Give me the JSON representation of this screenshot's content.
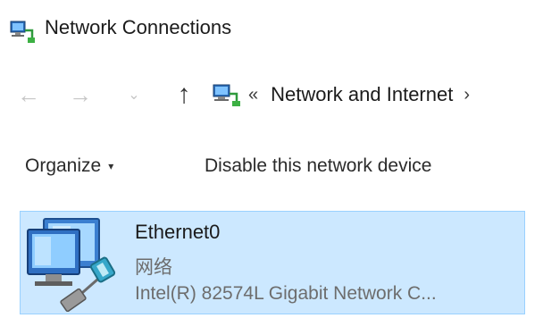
{
  "window": {
    "title": "Network Connections",
    "icon": "network-connections-icon"
  },
  "nav": {
    "back_glyph": "←",
    "forward_glyph": "→",
    "recent_glyph": "⌄",
    "up_glyph": "↑",
    "address": {
      "icon": "network-connections-icon",
      "overflow_glyph": "«",
      "crumb": "Network and Internet",
      "separator_glyph": "›"
    }
  },
  "commandbar": {
    "organize_label": "Organize",
    "organize_caret": "▾",
    "disable_label": "Disable this network device"
  },
  "connections": [
    {
      "name": "Ethernet0",
      "status": "网络",
      "device": "Intel(R) 82574L Gigabit Network C...",
      "icon": "ethernet-adapter-icon",
      "selected": true
    }
  ],
  "colors": {
    "selection_bg": "#cce8ff",
    "selection_border": "#99d1ff",
    "disabled_nav": "#c6c6c6",
    "secondary_text": "#6d6d6d"
  }
}
